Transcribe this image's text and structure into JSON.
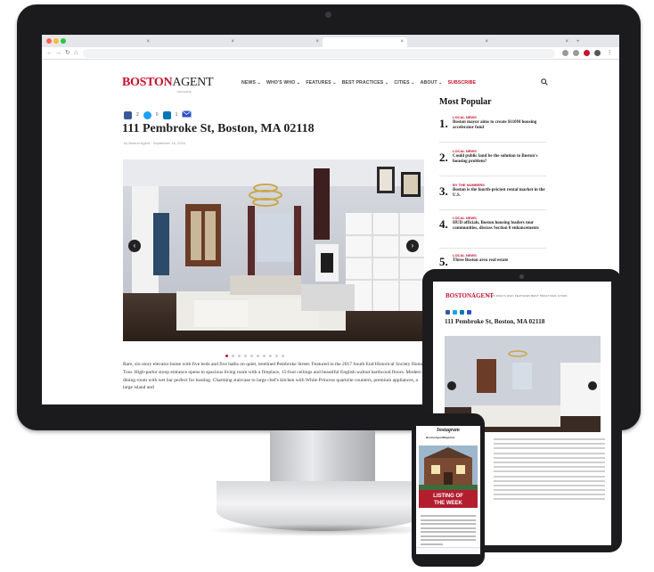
{
  "site": {
    "logo_part1": "BOSTON",
    "logo_part2": "AGENT",
    "logo_sub": "MAGAZINE",
    "nav": [
      "NEWS ⌄",
      "WHO'S WHO ⌄",
      "FEATURES ⌄",
      "BEST PRACTICES ⌄",
      "CITIES ⌄",
      "ABOUT ⌄",
      "SUBSCRIBE"
    ]
  },
  "share": {
    "facebook_count": "2",
    "twitter_count": "0",
    "linkedin_count": "1"
  },
  "article": {
    "title": "111 Pembroke St, Boston, MA 02118",
    "byline": "by Boston Agent · September 16, 2024",
    "body": "Rare, six-story elevator home with five beds and five baths on quiet, treelined Pembroke Street. Featured in the 2017 South End Historical Society Home Tour. High-parlor stoop entrance opens to spacious living room with a fireplace, 15-foot ceilings and beautiful English walnut hardwood floors. Modern dining room with wet bar perfect for hosting. Charming staircase to large chef's kitchen with White Princess quartzite counters, premium appliances, a large island and"
  },
  "sidebar": {
    "heading": "Most Popular",
    "items": [
      {
        "num": "1.",
        "cat": "LOCAL NEWS",
        "text": "Boston mayor aims to create $110M housing accelerator fund"
      },
      {
        "num": "2.",
        "cat": "LOCAL NEWS",
        "text": "Could public land be the solution to Boston's housing problem?"
      },
      {
        "num": "3.",
        "cat": "BY THE NUMBERS",
        "text": "Boston is the fourth-priciest rental market in the U.S."
      },
      {
        "num": "4.",
        "cat": "LOCAL NEWS",
        "text": "HUD officials, Boston housing leaders tour communities, discuss Section 8 enhancements"
      },
      {
        "num": "5.",
        "cat": "LOCAL NEWS",
        "text": "Three Boston area real estate"
      }
    ]
  },
  "tablet": {
    "logo": "BOSTONAGENT",
    "nav": "NEWS  WHO'S WHO  FEATURES  BEST PRACTICES  CITIES",
    "title": "111 Pembroke St, Boston, MA 02118"
  },
  "phone": {
    "app": "Instagram",
    "account": "BostonAgentMagazine",
    "overlay_line1": "LISTING OF",
    "overlay_line2": "THE WEEK"
  },
  "colors": {
    "brand_red": "#c8102e",
    "facebook": "#3b5998",
    "twitter": "#1da1f2",
    "linkedin": "#0077b5",
    "email": "#2b50c8"
  }
}
